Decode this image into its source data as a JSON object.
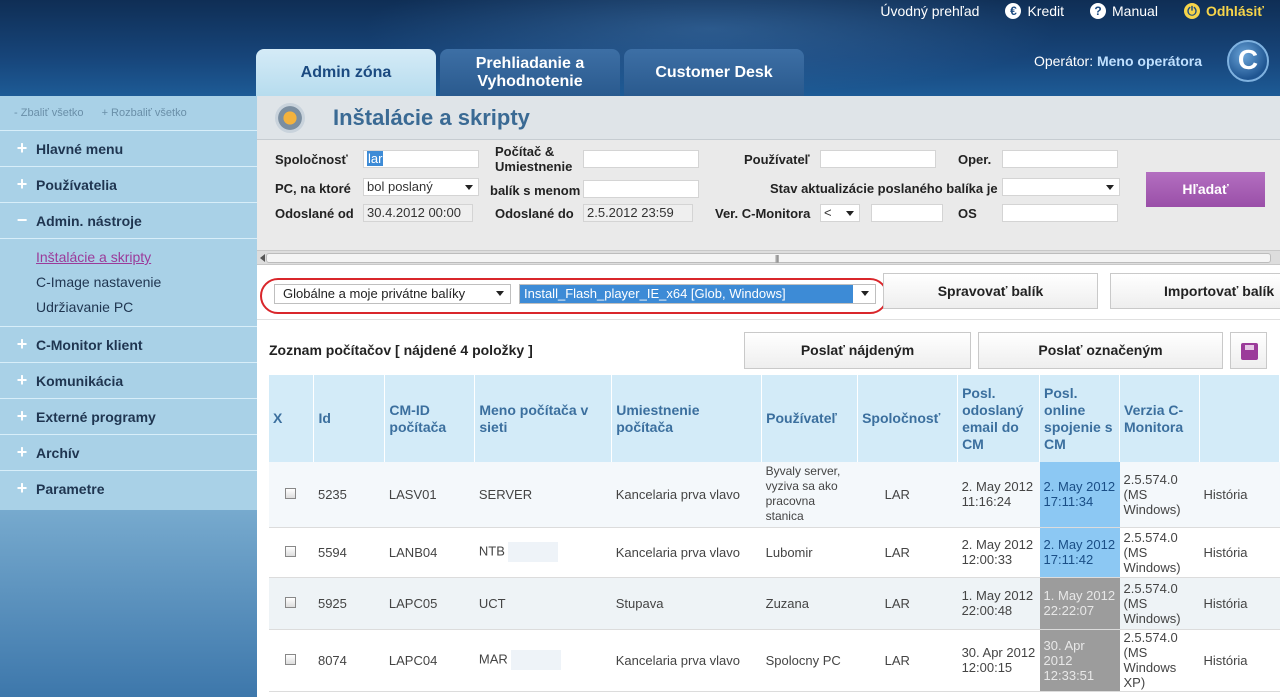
{
  "top_nav": {
    "overview": "Úvodný prehľad",
    "credit": "Kredit",
    "manual": "Manual",
    "logout": "Odhlásiť"
  },
  "tabs": [
    {
      "label": "Admin zóna",
      "active": true
    },
    {
      "label": "Prehliadanie a Vyhodnotenie",
      "active": false
    },
    {
      "label": "Customer Desk",
      "active": false
    }
  ],
  "operator": {
    "label": "Operátor:",
    "name": "Meno operátora"
  },
  "sidebar": {
    "collapse_all": "Zbaliť všetko",
    "expand_all": "Rozbaliť všetko",
    "items": [
      {
        "label": "Hlavné menu",
        "sign": "+"
      },
      {
        "label": "Používatelia",
        "sign": "+"
      },
      {
        "label": "Admin. nástroje",
        "sign": "−"
      },
      {
        "label": "C-Monitor klient",
        "sign": "+"
      },
      {
        "label": "Komunikácia",
        "sign": "+"
      },
      {
        "label": "Externé programy",
        "sign": "+"
      },
      {
        "label": "Archív",
        "sign": "+"
      },
      {
        "label": "Parametre",
        "sign": "+"
      }
    ],
    "submenu": [
      "Inštalácie a skripty",
      "C-Image nastavenie",
      "Udržiavanie PC"
    ]
  },
  "page": {
    "title": "Inštalácie a skripty"
  },
  "filters": {
    "company_label": "Spoločnosť",
    "company_value": "lar",
    "pc_location_label": "Počítač & Umiestnenie",
    "user_label": "Používateľ",
    "oper_label": "Oper.",
    "pc_which_label": "PC, na ktoré",
    "pc_which_value": "bol poslaný",
    "pkg_name_label": "balík s menom",
    "update_state_label": "Stav aktualizácie poslaného balíka je",
    "sent_from_label": "Odoslané od",
    "sent_from_value": "30.4.2012 00:00",
    "sent_to_label": "Odoslané do",
    "sent_to_value": "2.5.2012 23:59",
    "cm_version_label": "Ver. C-Monitora",
    "cm_version_op": "<",
    "os_label": "OS",
    "search_button": "Hľadať"
  },
  "packages": {
    "scope_value": "Globálne a moje privátne balíky",
    "package_value": "Install_Flash_player_IE_x64 [Glob, Windows]",
    "manage_button": "Spravovať balík",
    "import_button": "Importovať balík"
  },
  "list": {
    "title": "Zoznam počítačov",
    "found_prefix": "[ nájdené",
    "found_count": "4",
    "found_suffix": "položky ]",
    "send_found_button": "Poslať nájdeným",
    "send_marked_button": "Poslať označeným",
    "columns": [
      "X",
      "Id",
      "CM-ID počítača",
      "Meno počítača v sieti",
      "Umiestnenie počítača",
      "Používateľ",
      "Spoločnosť",
      "Posl. odoslaný email do CM",
      "Posl. online spojenie s CM",
      "Verzia C-Monitora",
      ""
    ],
    "rows": [
      {
        "id": "5235",
        "cmid": "LASV01",
        "name": "SERVER",
        "location": "Kancelaria prva vlavo",
        "user": "Byvaly server, vyziva sa ako pracovna stanica",
        "company": "LAR",
        "email": "2. May 2012 11:16:24",
        "online": "2. May 2012 17:11:34",
        "online_color": "blue",
        "version": "2.5.574.0 (MS Windows)",
        "history": "História"
      },
      {
        "id": "5594",
        "cmid": "LANB04",
        "name": "NTB",
        "location": "Kancelaria prva vlavo",
        "user": "Lubomir",
        "company": "LAR",
        "email": "2. May 2012 12:00:33",
        "online": "2. May 2012 17:11:42",
        "online_color": "blue",
        "version": "2.5.574.0 (MS Windows)",
        "history": "História"
      },
      {
        "id": "5925",
        "cmid": "LAPC05",
        "name": "UCT",
        "location": "Stupava",
        "user": "Zuzana",
        "company": "LAR",
        "email": "1. May 2012 22:00:48",
        "online": "1. May 2012 22:22:07",
        "online_color": "gray",
        "version": "2.5.574.0 (MS Windows)",
        "history": "História"
      },
      {
        "id": "8074",
        "cmid": "LAPC04",
        "name": "MAR",
        "location": "Kancelaria prva vlavo",
        "user": "Spolocny PC",
        "company": "LAR",
        "email": "30. Apr 2012 12:00:15",
        "online": "30. Apr 2012 12:33:51",
        "online_color": "gray",
        "version": "2.5.574.0 (MS Windows XP)",
        "history": "História"
      }
    ]
  },
  "colors": {
    "accent_purple": "#9b3b9a",
    "header_blue": "#17457a",
    "sidebar_blue": "#a9d1e7",
    "online_recent": "#8cc8f3",
    "online_old": "#9c9c9c",
    "highlight_red": "#d9262b"
  }
}
